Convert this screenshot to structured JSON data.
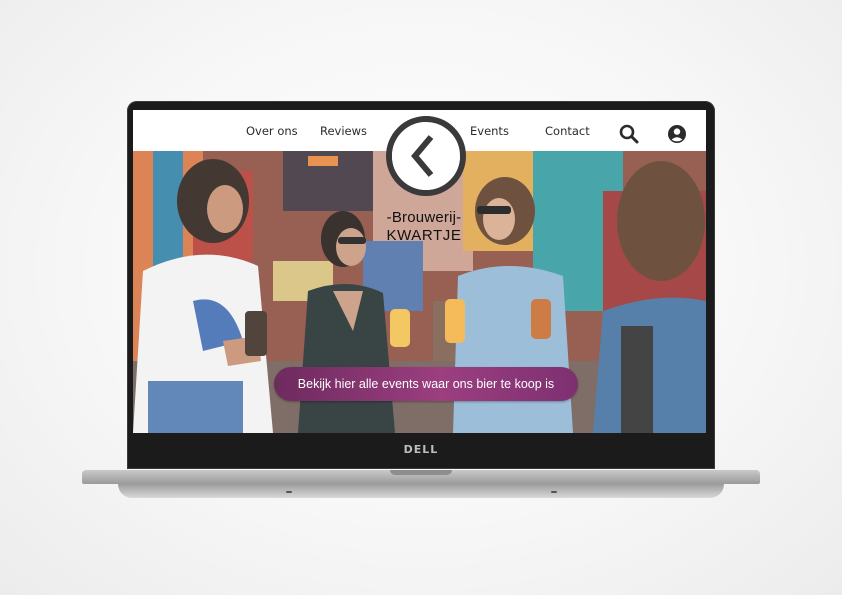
{
  "nav": {
    "links": [
      {
        "label": "Over ons"
      },
      {
        "label": "Reviews"
      },
      {
        "label": "Events"
      },
      {
        "label": "Contact"
      }
    ],
    "icons": [
      "search-icon",
      "user-account-icon"
    ]
  },
  "logo": {
    "line1": "-Brouwerij-",
    "line2": "KWARTJE"
  },
  "hero": {
    "cta_label": "Bekijk hier alle events waar ons bier te koop is"
  },
  "device": {
    "brand": "DELL"
  },
  "colors": {
    "cta": "#8a3674",
    "nav_text": "#2b2b2b",
    "logo": "#111111"
  }
}
